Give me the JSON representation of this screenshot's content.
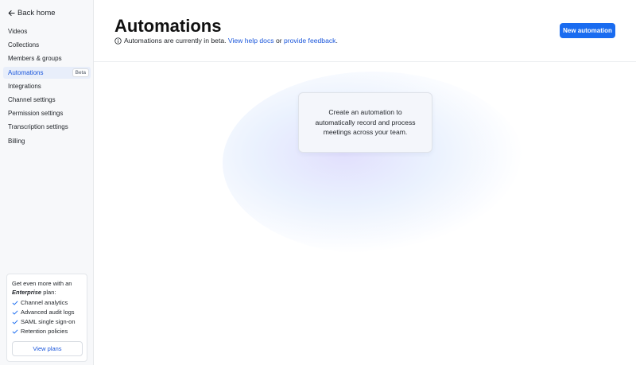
{
  "sidebar": {
    "back_label": "Back home",
    "items": [
      {
        "label": "Videos"
      },
      {
        "label": "Collections"
      },
      {
        "label": "Members & groups"
      },
      {
        "label": "Automations",
        "badge": "Beta",
        "active": true
      },
      {
        "label": "Integrations"
      },
      {
        "label": "Channel settings"
      },
      {
        "label": "Permission settings"
      },
      {
        "label": "Transcription settings"
      },
      {
        "label": "Billing"
      }
    ],
    "promo": {
      "text_prefix": "Get even more with an",
      "plan_name": "Enterprise",
      "text_suffix": "plan:",
      "features": [
        "Channel analytics",
        "Advanced audit logs",
        "SAML single sign-on",
        "Retention policies"
      ],
      "button_label": "View plans"
    }
  },
  "header": {
    "title": "Automations",
    "beta_notice": "Automations are currently in beta.",
    "help_link": "View help docs",
    "or_text": "or",
    "feedback_link": "provide feedback",
    "period": ".",
    "new_button": "New automation"
  },
  "empty_state": {
    "message": "Create an automation to automatically record and process meetings across your team."
  },
  "colors": {
    "accent": "#1a6cf0",
    "link": "#1a56db",
    "sidebar_bg": "#f7f8fa",
    "active_bg": "#e8eefa"
  }
}
